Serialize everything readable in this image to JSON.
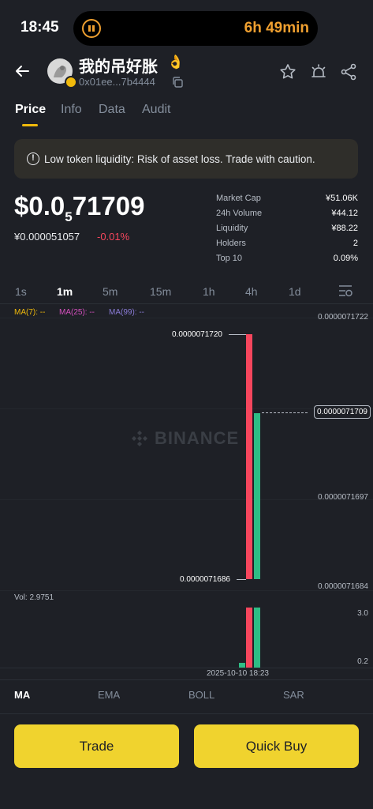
{
  "status": {
    "time": "18:45",
    "timer": "6h 49min"
  },
  "token": {
    "name": "我的吊好胀",
    "emoji": "👌",
    "address": "0x01ee...7b4444"
  },
  "tabs": [
    "Price",
    "Info",
    "Data",
    "Audit"
  ],
  "warning": "Low token liquidity: Risk of asset loss. Trade with caution.",
  "price": {
    "main_prefix": "$0.0",
    "sub": "5",
    "main_suffix": "71709",
    "cny": "¥0.000051057",
    "change": "-0.01%"
  },
  "stats": [
    {
      "label": "Market Cap",
      "value": "¥51.06K"
    },
    {
      "label": "24h Volume",
      "value": "¥44.12"
    },
    {
      "label": "Liquidity",
      "value": "¥88.22"
    },
    {
      "label": "Holders",
      "value": "2"
    },
    {
      "label": "Top 10",
      "value": "0.09%"
    }
  ],
  "intervals": [
    "1s",
    "1m",
    "5m",
    "15m",
    "1h",
    "4h",
    "1d"
  ],
  "active_interval": "1m",
  "ma_labels": [
    {
      "text": "MA(7): --",
      "color": "#f0b90b"
    },
    {
      "text": "MA(25): --",
      "color": "#d64fbf"
    },
    {
      "text": "MA(99): --",
      "color": "#8a7bd6"
    }
  ],
  "chart_data": {
    "type": "candlestick",
    "y_ticks": [
      "0.0000071722",
      "0.0000071709",
      "0.0000071697",
      "0.0000071684"
    ],
    "current_price": "0.0000071709",
    "high_label": "0.0000071720",
    "low_label": "0.0000071686",
    "watermark": "BINANCE",
    "candles": [
      {
        "open": 7.172e-06,
        "close": 7.1686e-06,
        "high": 7.172e-06,
        "low": 7.1686e-06,
        "color": "red"
      },
      {
        "open": 7.1686e-06,
        "close": 7.1709e-06,
        "high": 7.1709e-06,
        "low": 7.1686e-06,
        "color": "green"
      }
    ],
    "volume": {
      "label": "Vol: 2.9751",
      "ticks": [
        "3.0",
        "0.2"
      ],
      "bars": [
        0.2,
        3.0,
        3.0
      ]
    },
    "time_label": "2025-10-10 18:23"
  },
  "indicators": [
    "MA",
    "EMA",
    "BOLL",
    "SAR"
  ],
  "buttons": {
    "trade": "Trade",
    "quick_buy": "Quick Buy"
  },
  "colors": {
    "accent": "#f0b90b",
    "up": "#2ebd85",
    "down": "#f6465d",
    "bg": "#1e2026"
  }
}
